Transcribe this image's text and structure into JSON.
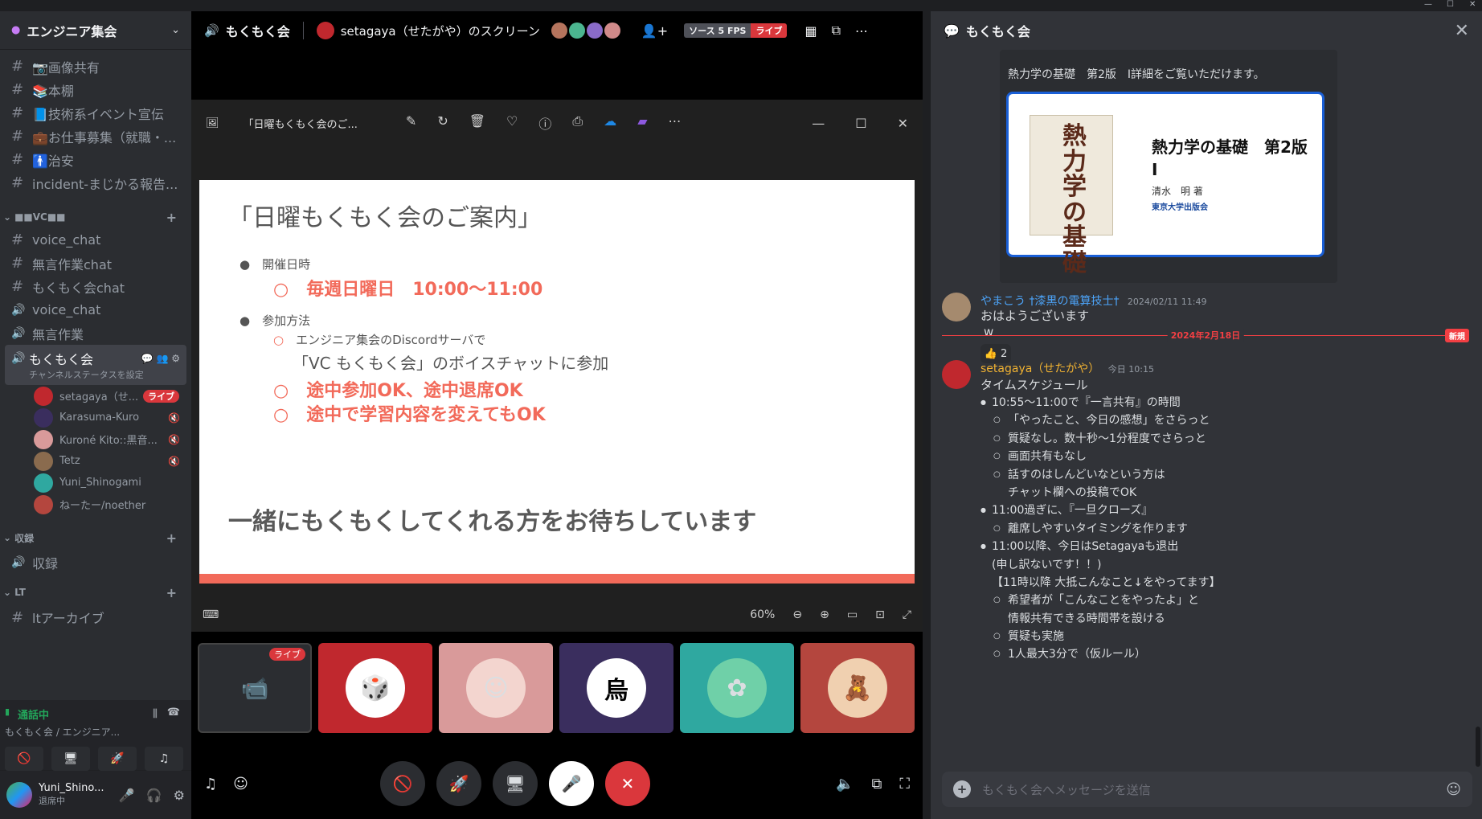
{
  "server": {
    "name": "エンジニア集会"
  },
  "sidebar": {
    "channels": [
      {
        "label": "📷画像共有"
      },
      {
        "label": "📚本棚"
      },
      {
        "label": "📘技術系イベント宣伝"
      },
      {
        "label": "💼お仕事募集（就職・..."
      },
      {
        "label": "🚹治安"
      },
      {
        "label": "incident-まじかる報告..."
      }
    ],
    "category_vc": "■■vc■■",
    "vc_channels": [
      {
        "label": "voice_chat",
        "type": "text"
      },
      {
        "label": "無言作業chat",
        "type": "text"
      },
      {
        "label": "もくもく会chat",
        "type": "text"
      },
      {
        "label": "voice_chat",
        "type": "voice"
      },
      {
        "label": "無言作業",
        "type": "voice"
      }
    ],
    "active_channel": {
      "label": "もくもく会",
      "status": "チャンネルステータスを設定"
    },
    "voice_users": [
      {
        "name": "setagaya（せ...",
        "live": "ライブ"
      },
      {
        "name": "Karasuma-Kuro"
      },
      {
        "name": "Kuroné Kito::黒音..."
      },
      {
        "name": "Tetz"
      },
      {
        "name": "Yuni_Shinogami"
      },
      {
        "name": "ねーたー/noether"
      }
    ],
    "category_archive": "収録",
    "archive_channel": "収録",
    "category_lt": "LT",
    "lt_channel": "ltアーカイブ"
  },
  "voice_panel": {
    "status": "通話中",
    "location": "もくもく会 / エンジニア..."
  },
  "user": {
    "name": "Yuni_Shino...",
    "status": "退席中"
  },
  "stage": {
    "channel": "もくもく会",
    "screen_title": "setagaya（せたがや）のスクリーン",
    "source": "ソース 5 FPS",
    "live": "ライブ"
  },
  "viewer": {
    "doc_title": "「日曜もくもく会のご...",
    "zoom": "60%"
  },
  "slide": {
    "title": "「日曜もくもく会のご案内」",
    "h1": "開催日時",
    "r1": "毎週日曜日　10:00〜11:00",
    "h2": "参加方法",
    "g1": "エンジニア集会のDiscordサーバで",
    "g2": "「VC もくもく会」のボイスチャットに参加",
    "r2": "途中参加OK、途中退席OK",
    "r3": "途中で学習内容を変えてもOK",
    "bottom": "一緒にもくもくしてくれる方をお待ちしています"
  },
  "tile_live": "ライブ",
  "chat": {
    "header": "もくもく会",
    "embed": {
      "desc": "熱力学の基礎　第2版　I詳細をご覧いただけます。",
      "card_title": "熱力学の基礎　第2版　I",
      "card_author": "清水　明 著",
      "card_publisher": "東京大学出版会",
      "book_kanji": "熱力学の基礎"
    },
    "msg1": {
      "author": "やまこう †漆黒の電算技士†",
      "time": "2024/02/11 11:49",
      "lines": [
        "おはようございます",
        "w"
      ],
      "reaction": "👍 2"
    },
    "divider": {
      "date": "2024年2月18日",
      "new": "新規"
    },
    "msg2": {
      "author": "setagaya（せたがや）",
      "time": "今日 10:15",
      "title": "タイムスケジュール",
      "items": [
        {
          "lvl": 1,
          "text": "10:55〜11:00で『一言共有』の時間"
        },
        {
          "lvl": 2,
          "text": "「やったこと、今日の感想」をさらっと"
        },
        {
          "lvl": 2,
          "text": "質疑なし。数十秒〜1分程度でさらっと"
        },
        {
          "lvl": 2,
          "text": "画面共有もなし"
        },
        {
          "lvl": 2,
          "text": "話すのはしんどいなという方は"
        },
        {
          "lvl": 0,
          "text": "チャット欄への投稿でOK"
        },
        {
          "lvl": 1,
          "text": "11:00過ぎに、『一旦クローズ』"
        },
        {
          "lvl": 2,
          "text": "離席しやすいタイミングを作ります"
        },
        {
          "lvl": 1,
          "text": "11:00以降、今日はSetagayaも退出"
        },
        {
          "lvl": 0,
          "text": "(申し訳ないです！！)"
        },
        {
          "lvl": 0,
          "text": "【11時以降 大抵こんなこと↓をやってます】"
        },
        {
          "lvl": 2,
          "text": "希望者が「こんなことをやったよ」と"
        },
        {
          "lvl": 0,
          "text": "情報共有できる時間帯を設ける"
        },
        {
          "lvl": 2,
          "text": "質疑も実施"
        },
        {
          "lvl": 2,
          "text": "1人最大3分で（仮ルール）"
        }
      ]
    },
    "input_placeholder": "もくもく会へメッセージを送信"
  }
}
